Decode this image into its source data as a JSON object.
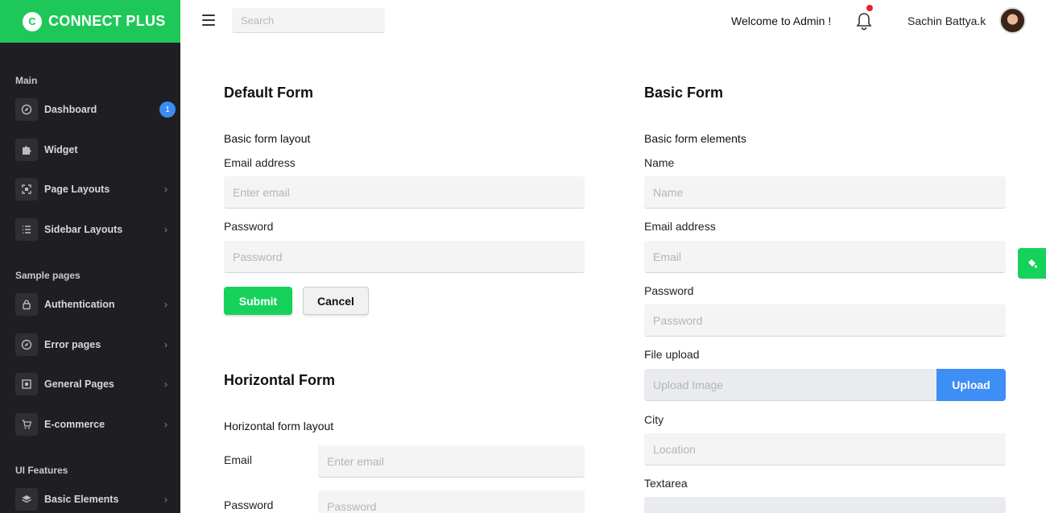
{
  "brand": {
    "logo_letter": "C",
    "name": "CONNECT PLUS",
    "color": "#1ec858"
  },
  "sidebar": {
    "sections": [
      {
        "title": "Main"
      },
      {
        "title": "Sample pages"
      },
      {
        "title": "UI Features"
      }
    ],
    "items": [
      {
        "label": "Dashboard",
        "icon": "compass-icon",
        "badge": "1"
      },
      {
        "label": "Widget",
        "icon": "puzzle-icon"
      },
      {
        "label": "Page Layouts",
        "icon": "expand-icon",
        "chevron": "›"
      },
      {
        "label": "Sidebar Layouts",
        "icon": "list-icon",
        "chevron": "›"
      },
      {
        "label": "Authentication",
        "icon": "lock-icon",
        "chevron": "›"
      },
      {
        "label": "Error pages",
        "icon": "compass-icon",
        "chevron": "›"
      },
      {
        "label": "General Pages",
        "icon": "grid-icon",
        "chevron": "›"
      },
      {
        "label": "E-commerce",
        "icon": "cart-icon",
        "chevron": "›"
      },
      {
        "label": "Basic Elements",
        "icon": "layers-icon",
        "chevron": "›"
      }
    ]
  },
  "header": {
    "search_placeholder": "Search",
    "welcome": "Welcome to Admin !",
    "user_name": "Sachin Battya.k"
  },
  "default_form": {
    "title": "Default Form",
    "subtitle": "Basic form layout",
    "email_label": "Email address",
    "email_placeholder": "Enter email",
    "password_label": "Password",
    "password_placeholder": "Password",
    "submit_label": "Submit",
    "cancel_label": "Cancel"
  },
  "horizontal_form": {
    "title": "Horizontal Form",
    "subtitle": "Horizontal form layout",
    "email_label": "Email",
    "email_placeholder": "Enter email",
    "password_label": "Password",
    "password_placeholder": "Password"
  },
  "basic_form": {
    "title": "Basic Form",
    "subtitle": "Basic form elements",
    "name_label": "Name",
    "name_placeholder": "Name",
    "email_label": "Email address",
    "email_placeholder": "Email",
    "password_label": "Password",
    "password_placeholder": "Password",
    "file_label": "File upload",
    "file_placeholder": "Upload Image",
    "upload_label": "Upload",
    "city_label": "City",
    "city_placeholder": "Location",
    "textarea_label": "Textarea"
  },
  "colors": {
    "sidebar_bg": "#1f1f23",
    "primary_green": "#16d25b",
    "upload_blue": "#3d8ef5",
    "badge_blue": "#3b8df5",
    "notification_red": "#e8202c"
  }
}
